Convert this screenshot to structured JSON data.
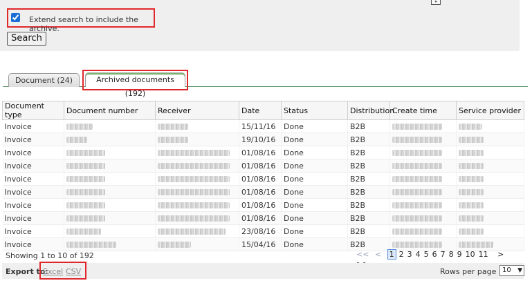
{
  "search": {
    "archive_checked": true,
    "archive_label": "Extend search to include the archive.",
    "search_button": "Search"
  },
  "tabs": [
    {
      "label": "Document (24)"
    },
    {
      "label": "Archived documents (192)"
    }
  ],
  "table": {
    "columns": [
      "Document type",
      "Document number",
      "Receiver",
      "Date",
      "Status",
      "Distribution",
      "Create time",
      "Service provider"
    ],
    "rows": [
      {
        "type": "Invoice",
        "date": "15/11/16",
        "status": "Done",
        "distribution": "B2B"
      },
      {
        "type": "Invoice",
        "date": "19/10/16",
        "status": "Done",
        "distribution": "B2B"
      },
      {
        "type": "Invoice",
        "date": "01/08/16",
        "status": "Done",
        "distribution": "B2B"
      },
      {
        "type": "Invoice",
        "date": "01/08/16",
        "status": "Done",
        "distribution": "B2B"
      },
      {
        "type": "Invoice",
        "date": "01/08/16",
        "status": "Done",
        "distribution": "B2B"
      },
      {
        "type": "Invoice",
        "date": "01/08/16",
        "status": "Done",
        "distribution": "B2B"
      },
      {
        "type": "Invoice",
        "date": "01/08/16",
        "status": "Done",
        "distribution": "B2B"
      },
      {
        "type": "Invoice",
        "date": "01/08/16",
        "status": "Done",
        "distribution": "B2B"
      },
      {
        "type": "Invoice",
        "date": "23/08/16",
        "status": "Done",
        "distribution": "B2B"
      },
      {
        "type": "Invoice",
        "date": "15/04/16",
        "status": "Done",
        "distribution": "B2B"
      }
    ]
  },
  "pagination": {
    "showing": "Showing 1 to 10 of 192",
    "first": "<<",
    "prev": "<",
    "pages": [
      "1",
      "2",
      "3",
      "4",
      "5",
      "6",
      "7",
      "8",
      "9",
      "10",
      "11"
    ],
    "current": "1",
    "next": ">",
    "last": ">>"
  },
  "export": {
    "label": "Export to:",
    "excel": "Excel",
    "csv": "CSV",
    "rows_per_page_label": "Rows per page",
    "rows_per_page_value": "10"
  },
  "colors": {
    "highlight": "#e0282c",
    "tab_underline": "#4f8c5a",
    "current_page": "#dbe8fb"
  }
}
